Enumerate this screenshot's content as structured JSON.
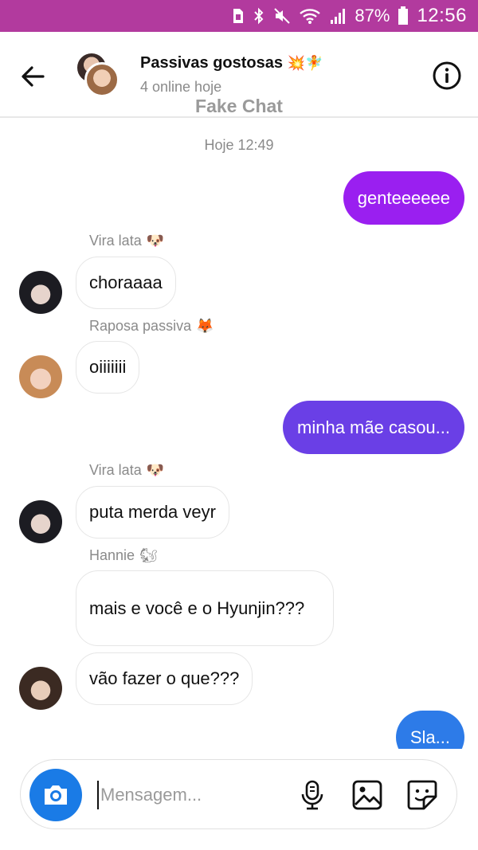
{
  "status_bar": {
    "battery_text": "87%",
    "time": "12:56"
  },
  "header": {
    "title": "Passivas gostosas",
    "title_emojis": "💥🧚",
    "subtitle": "4 online hoje",
    "watermark": "Fake Chat"
  },
  "conversation": {
    "timestamp": "Hoje 12:49",
    "outgoing": [
      {
        "text": "genteeeeee",
        "color": "#9a1ff0"
      },
      {
        "text": "minha mãe casou...",
        "color": "#6a3fe6"
      },
      {
        "text": "Sla...",
        "color": "#2d7be8"
      }
    ],
    "incoming": [
      {
        "sender": "Vira lata",
        "sender_emoji": "🐶",
        "text": "choraaaa"
      },
      {
        "sender": "Raposa passiva",
        "sender_emoji": "🦊",
        "text": "oiiiiiii"
      },
      {
        "sender": "Vira lata",
        "sender_emoji": "🐶",
        "text": "puta merda veyr"
      },
      {
        "sender": "Hannie",
        "sender_emoji": "🐿",
        "text": "mais e você e o Hyunjin???"
      },
      {
        "text": "vão fazer o que???"
      }
    ]
  },
  "composer": {
    "placeholder": "Mensagem...",
    "accent": "#1a7be6"
  },
  "icons": [
    "back-arrow-icon",
    "info-icon",
    "camera-icon",
    "microphone-icon",
    "gallery-icon",
    "sticker-icon"
  ]
}
